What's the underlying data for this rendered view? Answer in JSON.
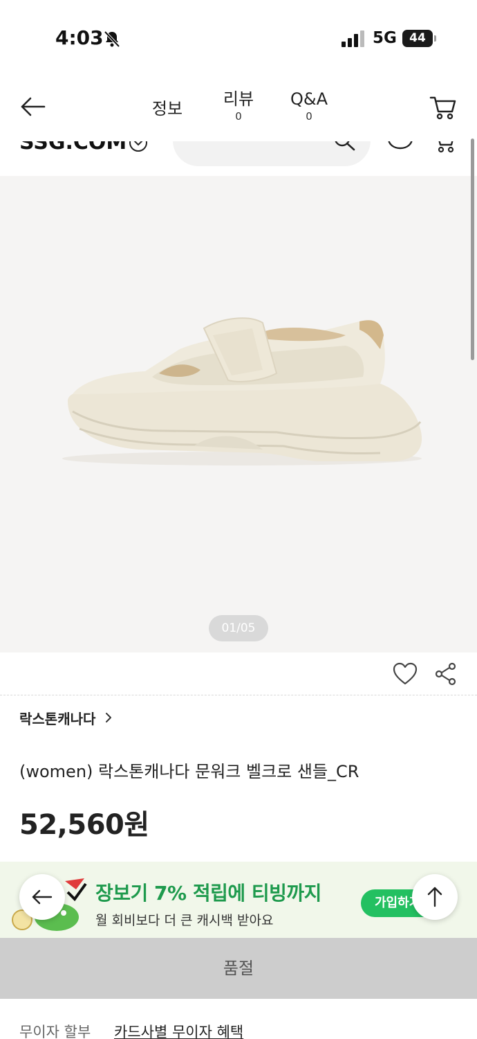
{
  "status_bar": {
    "time": "4:03",
    "network": "5G",
    "battery": "44"
  },
  "nav": {
    "tabs": [
      {
        "label": "정보",
        "count": ""
      },
      {
        "label": "리뷰",
        "count": "0"
      },
      {
        "label": "Q&A",
        "count": "0"
      }
    ]
  },
  "header": {
    "logo": "SSG.COM"
  },
  "gallery": {
    "counter": "01/05",
    "current": 1,
    "total": 5
  },
  "product": {
    "brand": "락스톤캐나다",
    "name": "(women) 락스톤캐나다 문워크 벨크로 샌들_CR",
    "price": "52,560원"
  },
  "promo": {
    "title": "장보기 7% 적립에 티빙까지",
    "subtitle": "월 회비보다 더 큰 캐시백 받아요",
    "join_label": "가입하기",
    "accent_color": "#1e9a4d",
    "button_color": "#23c061"
  },
  "purchase": {
    "soldout_label": "품절"
  },
  "installment": {
    "label": "무이자 할부",
    "link": "카드사별 무이자 혜택"
  },
  "icons": [
    "bell-muted-icon",
    "signal-icon",
    "back-arrow-icon",
    "cart-icon",
    "chevron-down-icon",
    "search-icon",
    "mascot-icon",
    "heart-icon",
    "share-icon",
    "chevron-right-icon",
    "arrow-up-icon"
  ]
}
